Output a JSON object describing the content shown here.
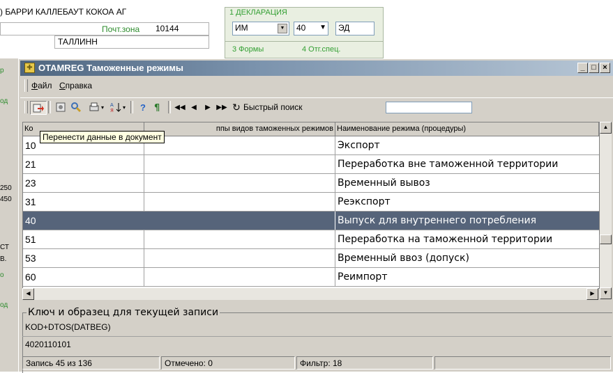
{
  "background": {
    "company": ") БАРРИ КАЛЛЕБАУТ КОКОА АГ",
    "postal_zone_label": "Почт.зона",
    "postal_zone_value": "10144",
    "city": "ТАЛЛИНН",
    "declaration_label": "1 ДЕКЛАРАЦИЯ",
    "decl_field1": "ИМ",
    "decl_field2": "40",
    "decl_field3": "ЭД",
    "forms_label": "3 Формы",
    "spec_label": "4 Отг.спец.",
    "side_fragments": [
      "р",
      "од",
      "250",
      "450",
      "СТ",
      "В.",
      "о",
      "од"
    ]
  },
  "window": {
    "title": "OTAMREG Таможенные режимы",
    "menu": [
      {
        "label": "Файл",
        "underline": "Ф",
        "rest": "айл"
      },
      {
        "label": "Справка",
        "underline": "С",
        "rest": "правка"
      }
    ],
    "toolbar": {
      "quick_search_label": "Быстрый поиск",
      "quick_search_value": ""
    },
    "grid": {
      "columns": [
        "Ко",
        "Группы видов таможенных режимов",
        "Наименование режима (процедуры)"
      ],
      "column2_visible": "ппы видов таможенных режимов",
      "rows": [
        {
          "code": "10",
          "group": "",
          "name": "Экспорт",
          "selected": false
        },
        {
          "code": "21",
          "group": "",
          "name": "Переработка вне таможенной территории",
          "selected": false
        },
        {
          "code": "23",
          "group": "",
          "name": "Временный вывоз",
          "selected": false
        },
        {
          "code": "31",
          "group": "",
          "name": "Реэкспорт",
          "selected": false
        },
        {
          "code": "40",
          "group": "",
          "name": "Выпуск для внутреннего потребления",
          "selected": true
        },
        {
          "code": "51",
          "group": "",
          "name": "Переработка на таможенной территории",
          "selected": false
        },
        {
          "code": "53",
          "group": "",
          "name": "Временный ввоз (допуск)",
          "selected": false
        },
        {
          "code": "60",
          "group": "",
          "name": "Реимпорт",
          "selected": false
        }
      ]
    },
    "tooltip": "Перенести данные в документ",
    "key_group": {
      "legend": "Ключ и образец для текущей записи",
      "key": "KOD+DTOS(DATBEG)",
      "sample": "4020110101"
    },
    "status": {
      "record": "Запись 45 из 136",
      "marked": "Отмечено: 0",
      "filter": "Фильтр: 18"
    }
  }
}
